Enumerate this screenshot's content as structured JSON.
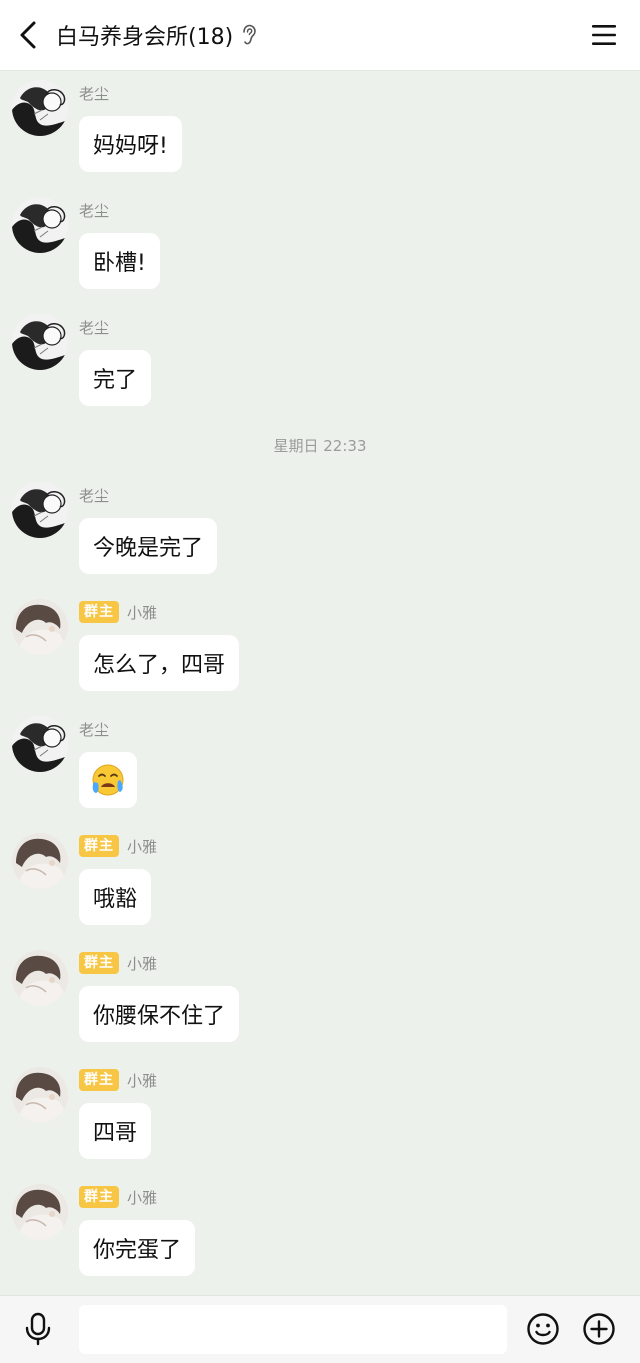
{
  "header": {
    "title": "白马养身会所(18)",
    "back_icon": "chevron-left-icon",
    "muted_icon": "ear-icon",
    "menu_icon": "hamburger-menu-icon"
  },
  "messages": [
    {
      "sender": "老尘",
      "text": "妈妈呀!"
    },
    {
      "sender": "老尘",
      "text": "卧槽!"
    },
    {
      "sender": "老尘",
      "text": "完了"
    },
    {
      "sender": "老尘",
      "text": "今晚是完了"
    },
    {
      "badge": "群主",
      "sender": "小雅",
      "text": "怎么了，四哥"
    },
    {
      "sender": "老尘",
      "emoji": "crying-face-icon"
    },
    {
      "badge": "群主",
      "sender": "小雅",
      "text": "哦豁"
    },
    {
      "badge": "群主",
      "sender": "小雅",
      "text": "你腰保不住了"
    },
    {
      "badge": "群主",
      "sender": "小雅",
      "text": "四哥"
    },
    {
      "badge": "群主",
      "sender": "小雅",
      "text": "你完蛋了"
    }
  ],
  "timestamp": "星期日 22:33",
  "input": {
    "placeholder": "",
    "value": ""
  },
  "colors": {
    "background": "#edf1ec",
    "bubble": "#ffffff",
    "owner_badge": "#f7c644"
  }
}
